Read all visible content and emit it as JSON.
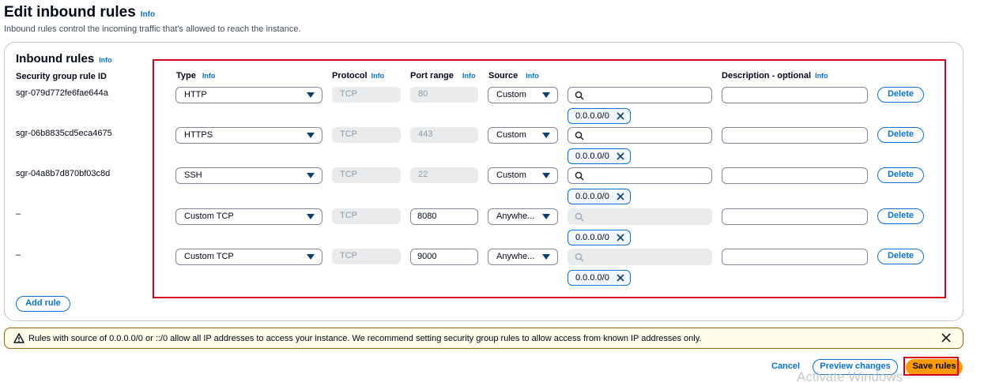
{
  "header": {
    "title": "Edit inbound rules",
    "title_info": "Info",
    "description": "Inbound rules control the incoming traffic that's allowed to reach the instance."
  },
  "panel": {
    "title": "Inbound rules",
    "title_info": "Info",
    "id_column_header": "Security group rule ID",
    "columns": {
      "type": "Type",
      "type_info": "Info",
      "protocol": "Protocol",
      "protocol_info": "Info",
      "port_range": "Port range",
      "port_range_info": "Info",
      "source": "Source",
      "source_info": "Info",
      "description": "Description - optional",
      "description_info": "Info"
    },
    "rules": [
      {
        "id": "sgr-079d772fe6fae644a",
        "type": "HTTP",
        "protocol": "TCP",
        "port_range": "80",
        "source": "Custom",
        "cidr": "0.0.0.0/0",
        "description": "",
        "delete_label": "Delete"
      },
      {
        "id": "sgr-06b8835cd5eca4675",
        "type": "HTTPS",
        "protocol": "TCP",
        "port_range": "443",
        "source": "Custom",
        "cidr": "0.0.0.0/0",
        "description": "",
        "delete_label": "Delete"
      },
      {
        "id": "sgr-04a8b7d870bf03c8d",
        "type": "SSH",
        "protocol": "TCP",
        "port_range": "22",
        "source": "Custom",
        "cidr": "0.0.0.0/0",
        "description": "",
        "delete_label": "Delete"
      },
      {
        "id": "–",
        "type": "Custom TCP",
        "protocol": "TCP",
        "port_range": "8080",
        "source": "Anywhe...",
        "cidr": "0.0.0.0/0",
        "description": "",
        "delete_label": "Delete"
      },
      {
        "id": "–",
        "type": "Custom TCP",
        "protocol": "TCP",
        "port_range": "9000",
        "source": "Anywhe...",
        "cidr": "0.0.0.0/0",
        "description": "",
        "delete_label": "Delete"
      }
    ],
    "add_rule_label": "Add rule"
  },
  "warning": {
    "icon": "warning-icon",
    "text": "Rules with source of 0.0.0.0/0 or ::/0 allow all IP addresses to access your instance. We recommend setting security group rules to allow access from known IP addresses only."
  },
  "footer": {
    "cancel_label": "Cancel",
    "preview_label": "Preview changes",
    "save_label": "Save rules"
  },
  "watermark": "Activate Windows",
  "colors": {
    "link": "#0972d3",
    "primary": "#ff9900",
    "highlight": "#d0021b",
    "warning_bg": "#fffce9"
  }
}
